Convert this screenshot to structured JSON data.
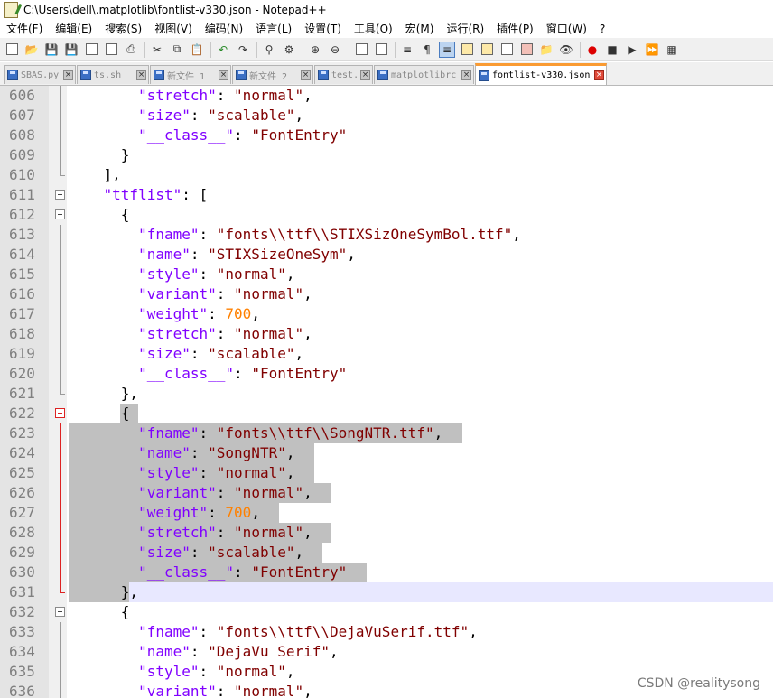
{
  "window": {
    "title": "C:\\Users\\dell\\.matplotlib\\fontlist-v330.json - Notepad++"
  },
  "menu": [
    "文件(F)",
    "编辑(E)",
    "搜索(S)",
    "视图(V)",
    "编码(N)",
    "语言(L)",
    "设置(T)",
    "工具(O)",
    "宏(M)",
    "运行(R)",
    "插件(P)",
    "窗口(W)",
    "?"
  ],
  "tabs": [
    {
      "label": "SBAS.py",
      "active": false
    },
    {
      "label": "ts.sh",
      "active": false
    },
    {
      "label": "新文件 1",
      "active": false
    },
    {
      "label": "新文件 2",
      "active": false
    },
    {
      "label": "test.sh",
      "active": false
    },
    {
      "label": "matplotlibrc",
      "active": false
    },
    {
      "label": "fontlist-v330.json",
      "active": true
    }
  ],
  "editor": {
    "lines": [
      {
        "num": "606",
        "text": "    \"stretch\": \"normal\","
      },
      {
        "num": "607",
        "text": "    \"size\": \"scalable\","
      },
      {
        "num": "608",
        "text": "    \"__class__\": \"FontEntry\""
      },
      {
        "num": "609",
        "text": "  }"
      },
      {
        "num": "610",
        "text": "],"
      },
      {
        "num": "611",
        "text": "\"ttflist\": ["
      },
      {
        "num": "612",
        "text": "  {"
      },
      {
        "num": "613",
        "text": "    \"fname\": \"fonts\\\\ttf\\\\STIXSizOneSymBol.ttf\","
      },
      {
        "num": "614",
        "text": "    \"name\": \"STIXSizeOneSym\","
      },
      {
        "num": "615",
        "text": "    \"style\": \"normal\","
      },
      {
        "num": "616",
        "text": "    \"variant\": \"normal\","
      },
      {
        "num": "617",
        "text": "    \"weight\": 700,"
      },
      {
        "num": "618",
        "text": "    \"stretch\": \"normal\","
      },
      {
        "num": "619",
        "text": "    \"size\": \"scalable\","
      },
      {
        "num": "620",
        "text": "    \"__class__\": \"FontEntry\""
      },
      {
        "num": "621",
        "text": "  },"
      },
      {
        "num": "622",
        "text": "  {"
      },
      {
        "num": "623",
        "text": "    \"fname\": \"fonts\\\\ttf\\\\SongNTR.ttf\","
      },
      {
        "num": "624",
        "text": "    \"name\": \"SongNTR\","
      },
      {
        "num": "625",
        "text": "    \"style\": \"normal\","
      },
      {
        "num": "626",
        "text": "    \"variant\": \"normal\","
      },
      {
        "num": "627",
        "text": "    \"weight\": 700,"
      },
      {
        "num": "628",
        "text": "    \"stretch\": \"normal\","
      },
      {
        "num": "629",
        "text": "    \"size\": \"scalable\","
      },
      {
        "num": "630",
        "text": "    \"__class__\": \"FontEntry\""
      },
      {
        "num": "631",
        "text": "  },"
      },
      {
        "num": "632",
        "text": "  {"
      },
      {
        "num": "633",
        "text": "    \"fname\": \"fonts\\\\ttf\\\\DejaVuSerif.ttf\","
      },
      {
        "num": "634",
        "text": "    \"name\": \"DejaVu Serif\","
      },
      {
        "num": "635",
        "text": "    \"style\": \"normal\","
      },
      {
        "num": "636",
        "text": "    \"variant\": \"normal\","
      }
    ],
    "selection": {
      "from": "622",
      "to": "631"
    },
    "current_line": "631"
  },
  "watermark": "CSDN @realitysong",
  "colors": {
    "key": "#8000ff",
    "string": "#800000",
    "number": "#ff8000",
    "selection": "#c0c0c0",
    "current_line": "#e8e8ff",
    "active_tab_accent": "#fa9b32"
  }
}
